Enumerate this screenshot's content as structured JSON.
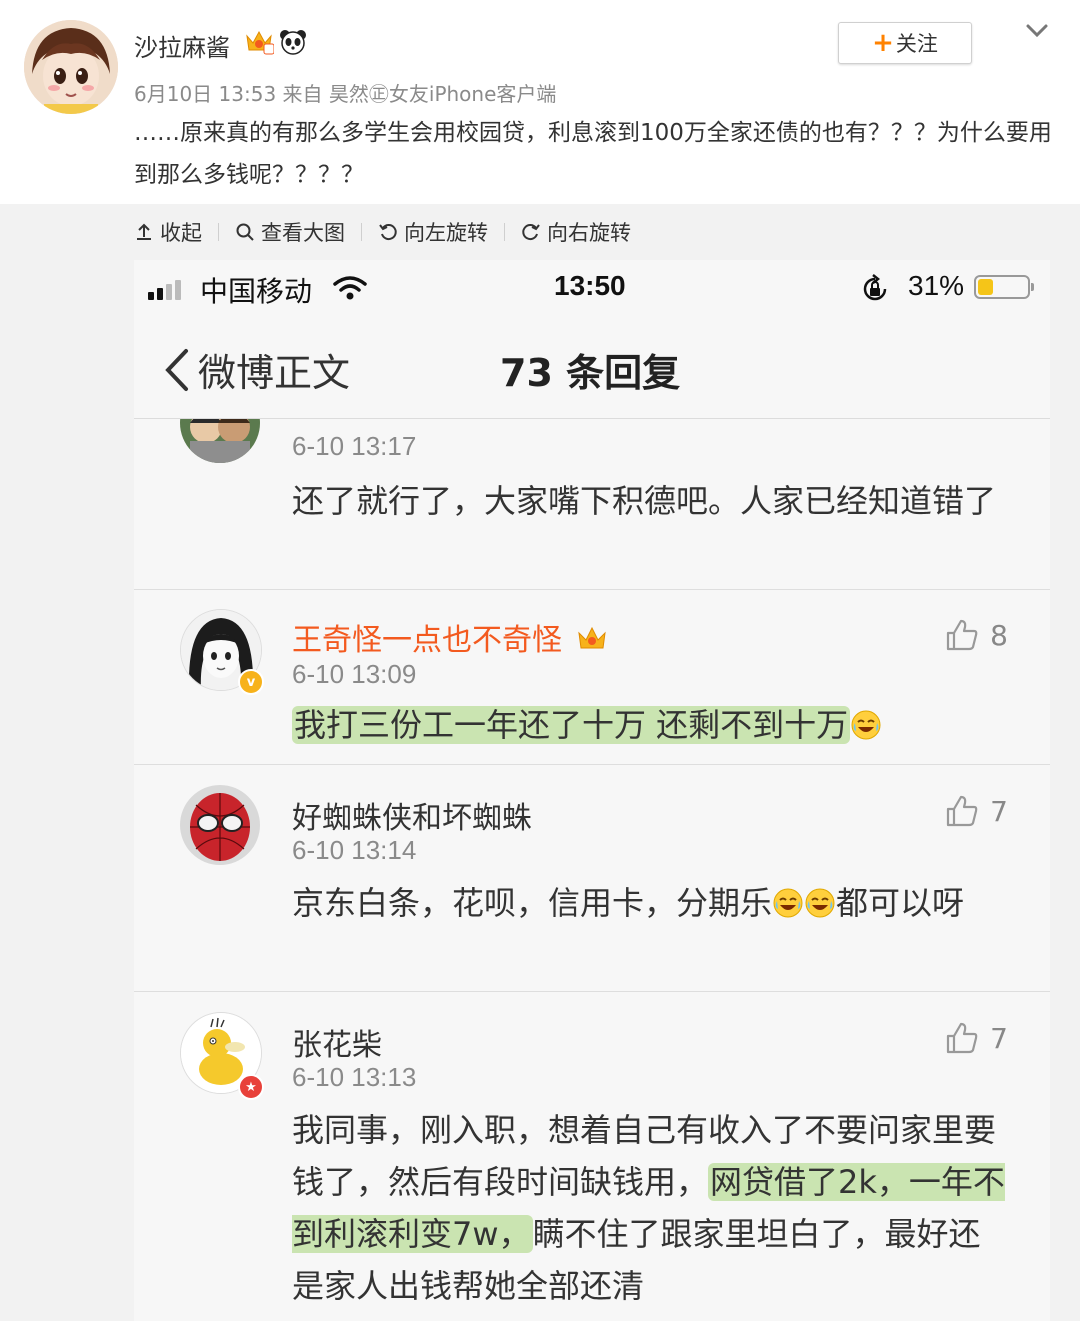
{
  "post": {
    "author": "沙拉麻酱",
    "follow_label": "关注",
    "meta": "6月10日 13:53 来自 昊然㊣女友iPhone客户端",
    "text": "……原来真的有那么多学生会用校园贷，利息滚到100万全家还债的也有？？？为什么要用到那么多钱呢？？？？",
    "icons": [
      "vip-crown-icon",
      "panda-icon",
      "chevron-down-icon"
    ],
    "accent_color": "#ff8200"
  },
  "toolbar": {
    "collapse": "收起",
    "view_large": "查看大图",
    "rotate_left": "向左旋转",
    "rotate_right": "向右旋转"
  },
  "phone": {
    "status": {
      "carrier": "中国移动",
      "time": "13:50",
      "battery": "31%",
      "battery_level": 0.31
    },
    "nav": {
      "back_label": "微博正文",
      "title": "73 条回复"
    }
  },
  "comments": [
    {
      "name": "",
      "time": "6-10 13:17",
      "text": "还了就行了，大家嘴下积德吧。人家已经知道错了",
      "likes": ""
    },
    {
      "name": "王奇怪一点也不奇怪",
      "time": "6-10 13:09",
      "text": "我打三份工一年还了十万 还剩不到十万",
      "likes": "8",
      "name_color": "#f35a1f"
    },
    {
      "name": "好蜘蛛侠和坏蜘蛛",
      "time": "6-10 13:14",
      "text_a": "京东白条，花呗，信用卡，分期乐",
      "text_b": "都可以呀",
      "likes": "7"
    },
    {
      "name": "张花柴",
      "time": "6-10 13:13",
      "text_a": "我同事，刚入职，想着自己有收入了不要问家里要钱了，然后有段时间缺钱用，",
      "text_hl": "网贷借了2k，一年不到利滚利变7w，",
      "text_b": "瞒不住了跟家里坦白了，最好还是家人出钱帮她全部还清",
      "likes": "7"
    }
  ]
}
